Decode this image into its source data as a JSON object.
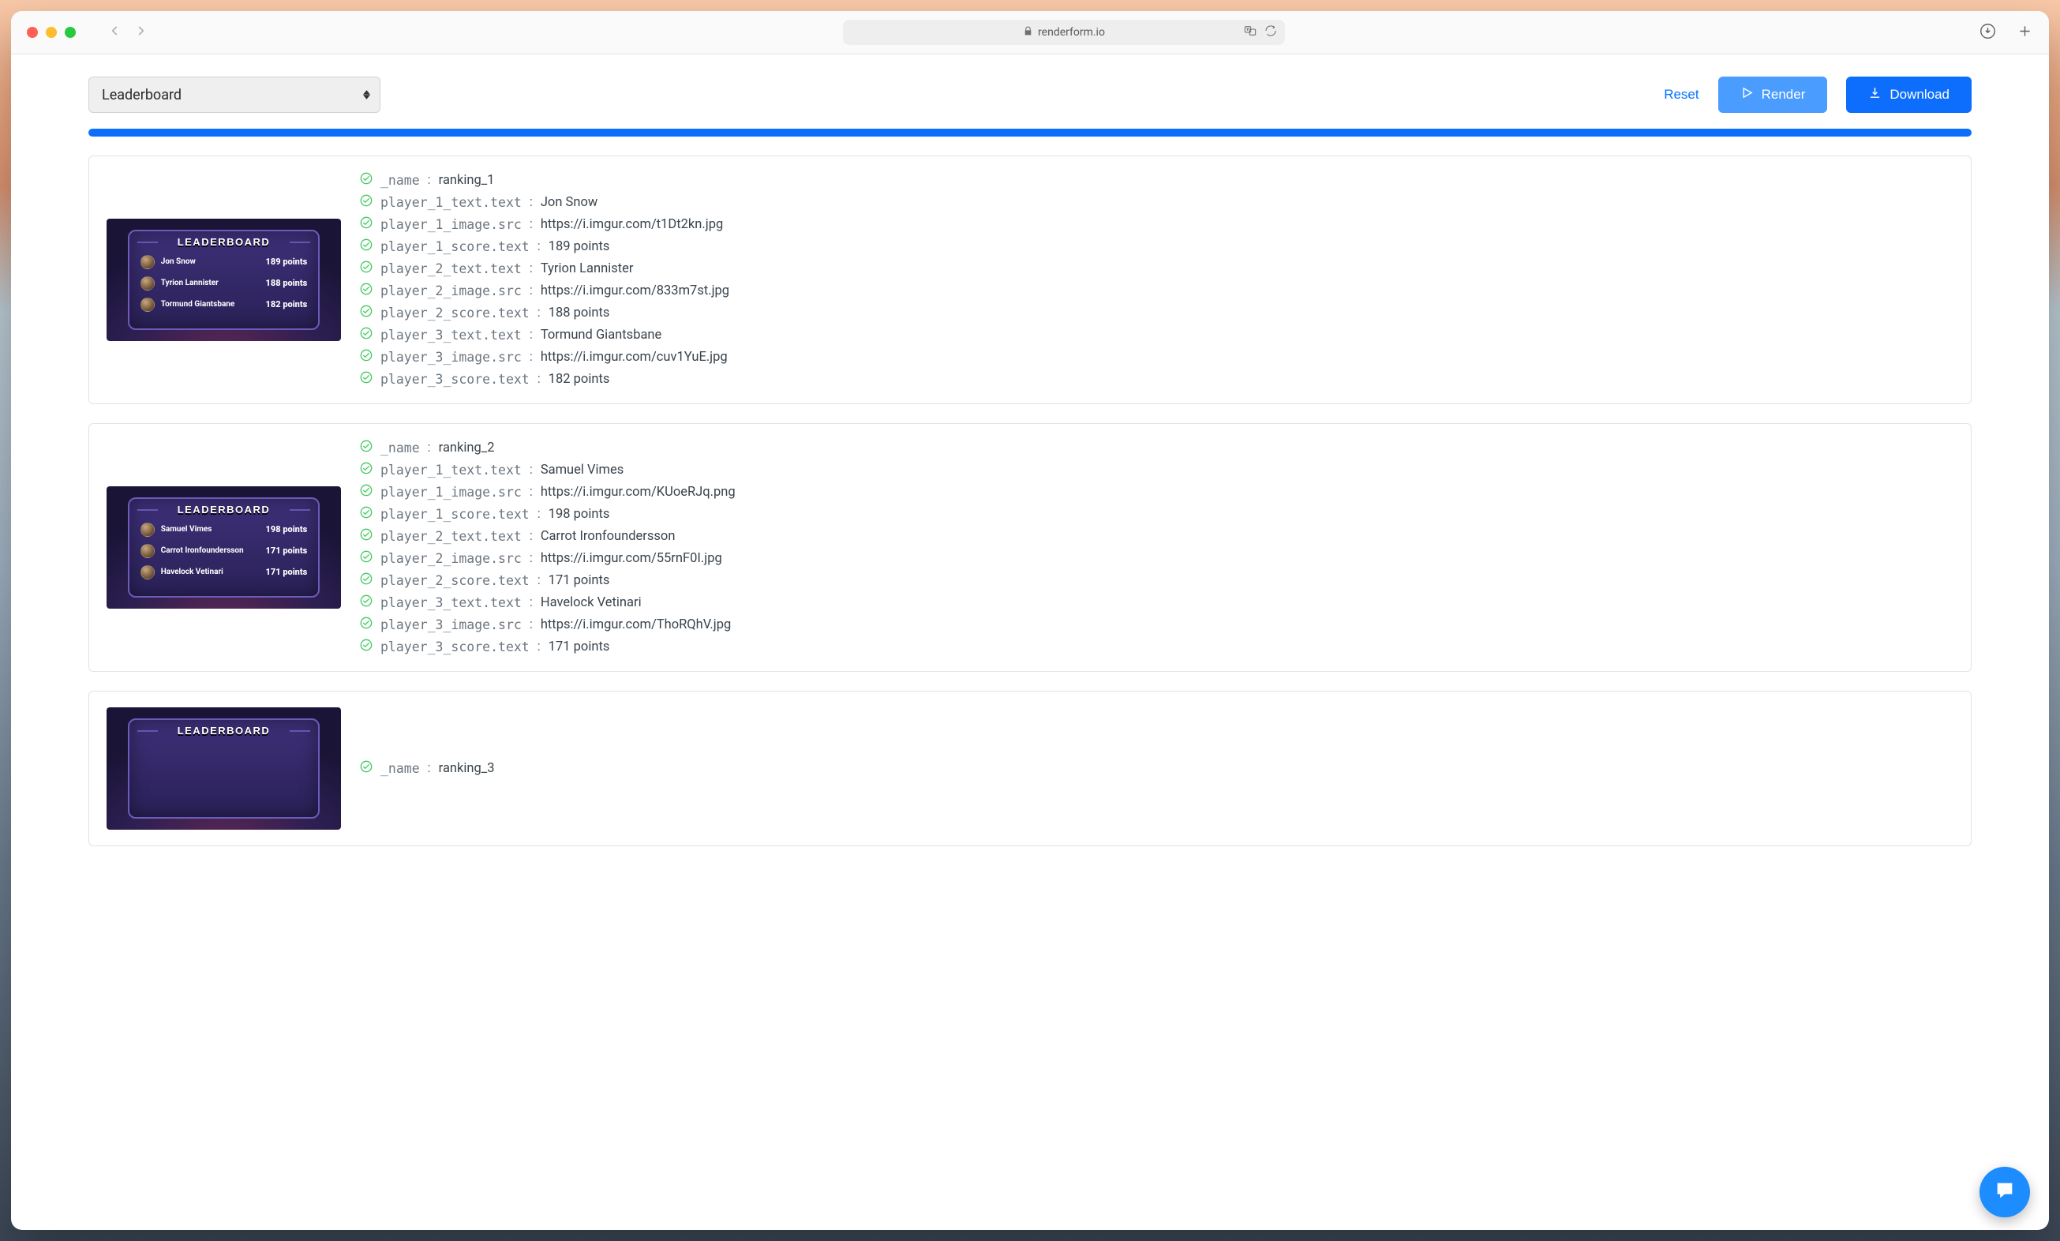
{
  "browser": {
    "url": "renderform.io"
  },
  "top": {
    "select_value": "Leaderboard",
    "reset": "Reset",
    "render": "Render",
    "download": "Download"
  },
  "thumbnail_title": "LEADERBOARD",
  "cards": [
    {
      "fields": [
        {
          "key": "_name",
          "value": "ranking_1"
        },
        {
          "key": "player_1_text.text",
          "value": "Jon Snow"
        },
        {
          "key": "player_1_image.src",
          "value": "https://i.imgur.com/t1Dt2kn.jpg"
        },
        {
          "key": "player_1_score.text",
          "value": "189 points"
        },
        {
          "key": "player_2_text.text",
          "value": "Tyrion Lannister"
        },
        {
          "key": "player_2_image.src",
          "value": "https://i.imgur.com/833m7st.jpg"
        },
        {
          "key": "player_2_score.text",
          "value": "188 points"
        },
        {
          "key": "player_3_text.text",
          "value": "Tormund Giantsbane"
        },
        {
          "key": "player_3_image.src",
          "value": "https://i.imgur.com/cuv1YuE.jpg"
        },
        {
          "key": "player_3_score.text",
          "value": "182 points"
        }
      ],
      "preview": [
        {
          "name": "Jon Snow",
          "score": "189 points"
        },
        {
          "name": "Tyrion Lannister",
          "score": "188 points"
        },
        {
          "name": "Tormund Giantsbane",
          "score": "182 points"
        }
      ]
    },
    {
      "fields": [
        {
          "key": "_name",
          "value": "ranking_2"
        },
        {
          "key": "player_1_text.text",
          "value": "Samuel Vimes"
        },
        {
          "key": "player_1_image.src",
          "value": "https://i.imgur.com/KUoeRJq.png"
        },
        {
          "key": "player_1_score.text",
          "value": "198 points"
        },
        {
          "key": "player_2_text.text",
          "value": "Carrot Ironfoundersson"
        },
        {
          "key": "player_2_image.src",
          "value": "https://i.imgur.com/55rnF0I.jpg"
        },
        {
          "key": "player_2_score.text",
          "value": "171 points"
        },
        {
          "key": "player_3_text.text",
          "value": "Havelock Vetinari"
        },
        {
          "key": "player_3_image.src",
          "value": "https://i.imgur.com/ThoRQhV.jpg"
        },
        {
          "key": "player_3_score.text",
          "value": "171 points"
        }
      ],
      "preview": [
        {
          "name": "Samuel Vimes",
          "score": "198 points"
        },
        {
          "name": "Carrot Ironfoundersson",
          "score": "171 points"
        },
        {
          "name": "Havelock Vetinari",
          "score": "171 points"
        }
      ]
    },
    {
      "fields": [
        {
          "key": "_name",
          "value": "ranking_3"
        }
      ],
      "preview": []
    }
  ]
}
